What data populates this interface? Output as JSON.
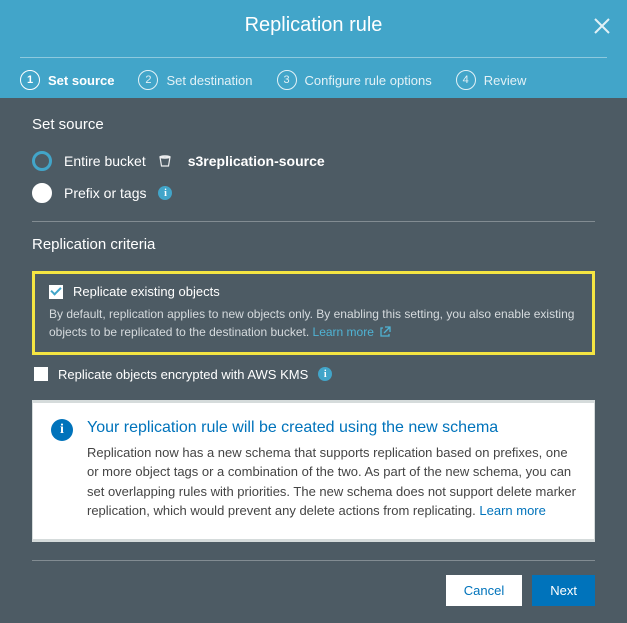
{
  "title": "Replication rule",
  "steps": [
    {
      "num": "1",
      "label": "Set source",
      "active": true
    },
    {
      "num": "2",
      "label": "Set destination",
      "active": false
    },
    {
      "num": "3",
      "label": "Configure rule options",
      "active": false
    },
    {
      "num": "4",
      "label": "Review",
      "active": false
    }
  ],
  "source": {
    "heading": "Set source",
    "option_entire": "Entire bucket",
    "bucket_name": "s3replication-source",
    "option_prefix": "Prefix or tags"
  },
  "criteria": {
    "heading": "Replication criteria",
    "replicate_existing_label": "Replicate existing objects",
    "replicate_existing_help": "By default, replication applies to new objects only. By enabling this setting, you also enable existing objects to be replicated to the destination bucket.",
    "replicate_kms_label": "Replicate objects encrypted with AWS KMS"
  },
  "info_panel": {
    "title": "Your replication rule will be created using the new schema",
    "text": "Replication now has a new schema that supports replication based on prefixes, one or more object tags or a combination of the two. As part of the new schema, you can set overlapping rules with priorities. The new schema does not support delete marker replication, which would prevent any delete actions from replicating."
  },
  "learn_more": "Learn more",
  "buttons": {
    "cancel": "Cancel",
    "next": "Next"
  }
}
